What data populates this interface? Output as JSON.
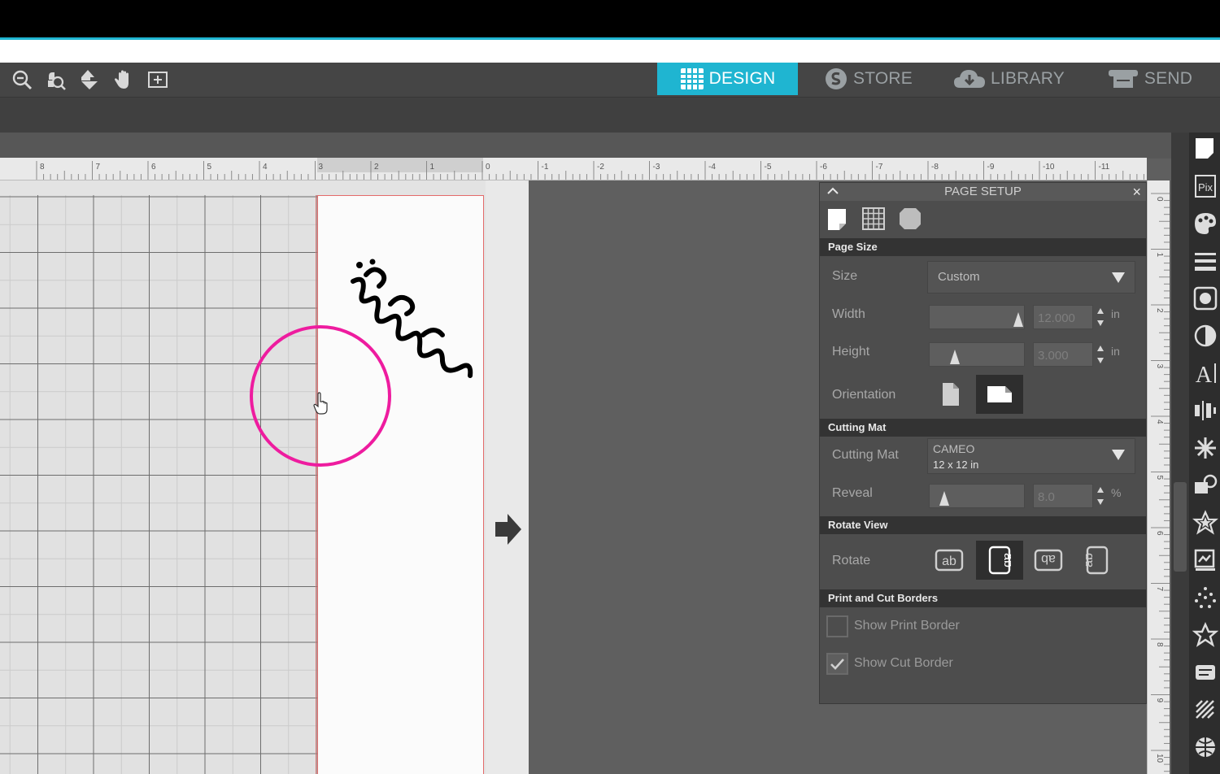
{
  "tabs": [
    {
      "label": "DESIGN",
      "icon": "design-grid-icon",
      "active": true
    },
    {
      "label": "STORE",
      "icon": "store-s-icon",
      "active": false
    },
    {
      "label": "LIBRARY",
      "icon": "cloud-library-icon",
      "active": false
    },
    {
      "label": "SEND",
      "icon": "send-plotter-icon",
      "active": false
    }
  ],
  "toolbar": {
    "icons": [
      "zoom-out-icon",
      "zoom-selected-icon",
      "move-down-icon",
      "pan-hand-icon",
      "fit-to-page-icon"
    ]
  },
  "ruler": {
    "top_labels": [
      "8",
      "7",
      "6",
      "5",
      "4",
      "3",
      "2",
      "1",
      "0",
      "1",
      "2",
      "3",
      "4",
      "5",
      "6",
      "7",
      "8",
      "9",
      "10",
      "11"
    ],
    "side_labels": [
      "0",
      "1",
      "2",
      "3",
      "4",
      "5",
      "6",
      "7",
      "8",
      "9",
      "10"
    ]
  },
  "panel": {
    "title": "PAGE SETUP",
    "close_symbol": "×",
    "sections": {
      "page_size": "Page Size",
      "cutting_mat": "Cutting Mat",
      "rotate_view": "Rotate View",
      "print_cut_borders": "Print and Cut Borders"
    },
    "size": {
      "label": "Size",
      "value": "Custom"
    },
    "width": {
      "label": "Width",
      "value": "12.000",
      "unit": "in",
      "slider_fraction": 0.97
    },
    "height": {
      "label": "Height",
      "value": "3.000",
      "unit": "in",
      "slider_fraction": 0.22
    },
    "orientation": {
      "label": "Orientation",
      "selected": "landscape"
    },
    "cutting_mat": {
      "label": "Cutting Mat",
      "value_line1": "CAMEO",
      "value_line2": "12 x 12 in"
    },
    "reveal": {
      "label": "Reveal",
      "value": "8.0",
      "unit": "%",
      "slider_fraction": 0.1
    },
    "rotate": {
      "label": "Rotate",
      "options": [
        "ab",
        "ab",
        "ab",
        "ab"
      ],
      "selected_index": 1
    },
    "show_print_border": {
      "label": "Show Print Border",
      "checked": false
    },
    "show_cut_border": {
      "label": "Show Cut Border",
      "checked": true
    }
  },
  "colors": {
    "accent": "#1fb5d1",
    "highlight_circle": "#ee1c9f",
    "page_border": "#e36a6a"
  }
}
